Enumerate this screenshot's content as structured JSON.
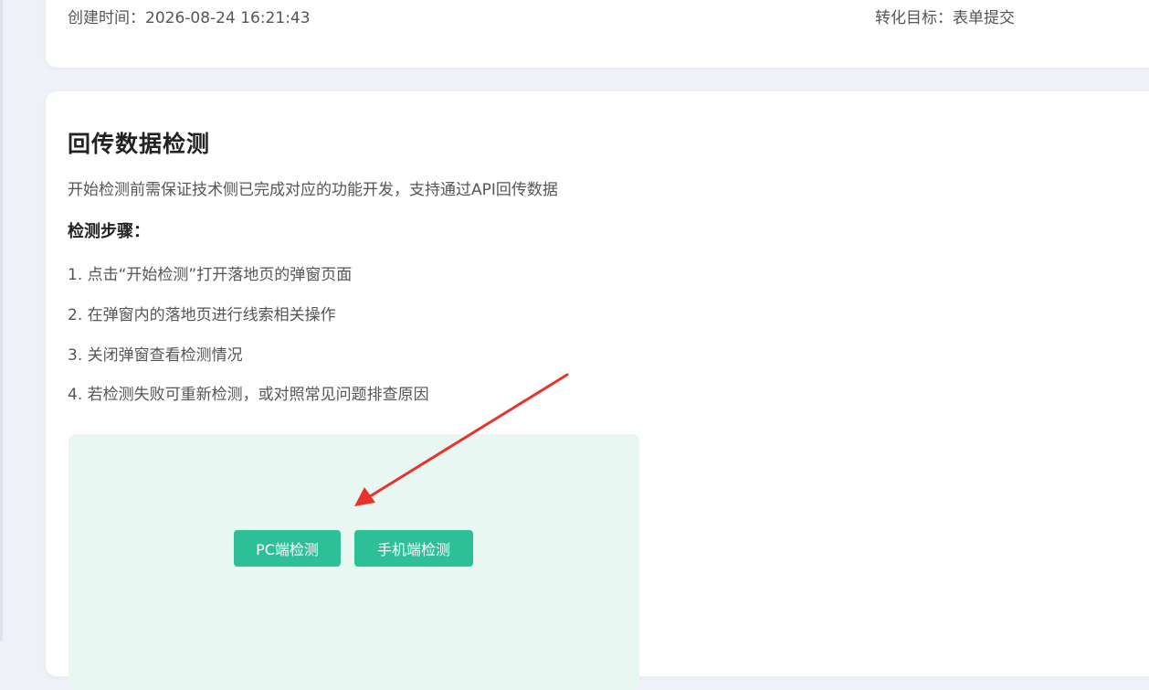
{
  "info_card": {
    "created_time": "创建时间：2026-08-24 16:21:43",
    "conversion_goal": "转化目标：表单提交"
  },
  "detection": {
    "title": "回传数据检测",
    "description": "开始检测前需保证技术侧已完成对应的功能开发，支持通过API回传数据",
    "steps_heading": "检测步骤：",
    "steps": [
      "1. 点击“开始检测”打开落地页的弹窗页面",
      "2. 在弹窗内的落地页进行线索相关操作",
      "3. 关闭弹窗查看检测情况",
      "4. 若检测失败可重新检测，或对照常见问题排查原因"
    ],
    "buttons": {
      "pc": "PC端检测",
      "mobile": "手机端检测"
    }
  },
  "colors": {
    "accent": "#2dbf95",
    "panel_bg": "#e9f7f2",
    "annotation_arrow": "#e8332a"
  }
}
